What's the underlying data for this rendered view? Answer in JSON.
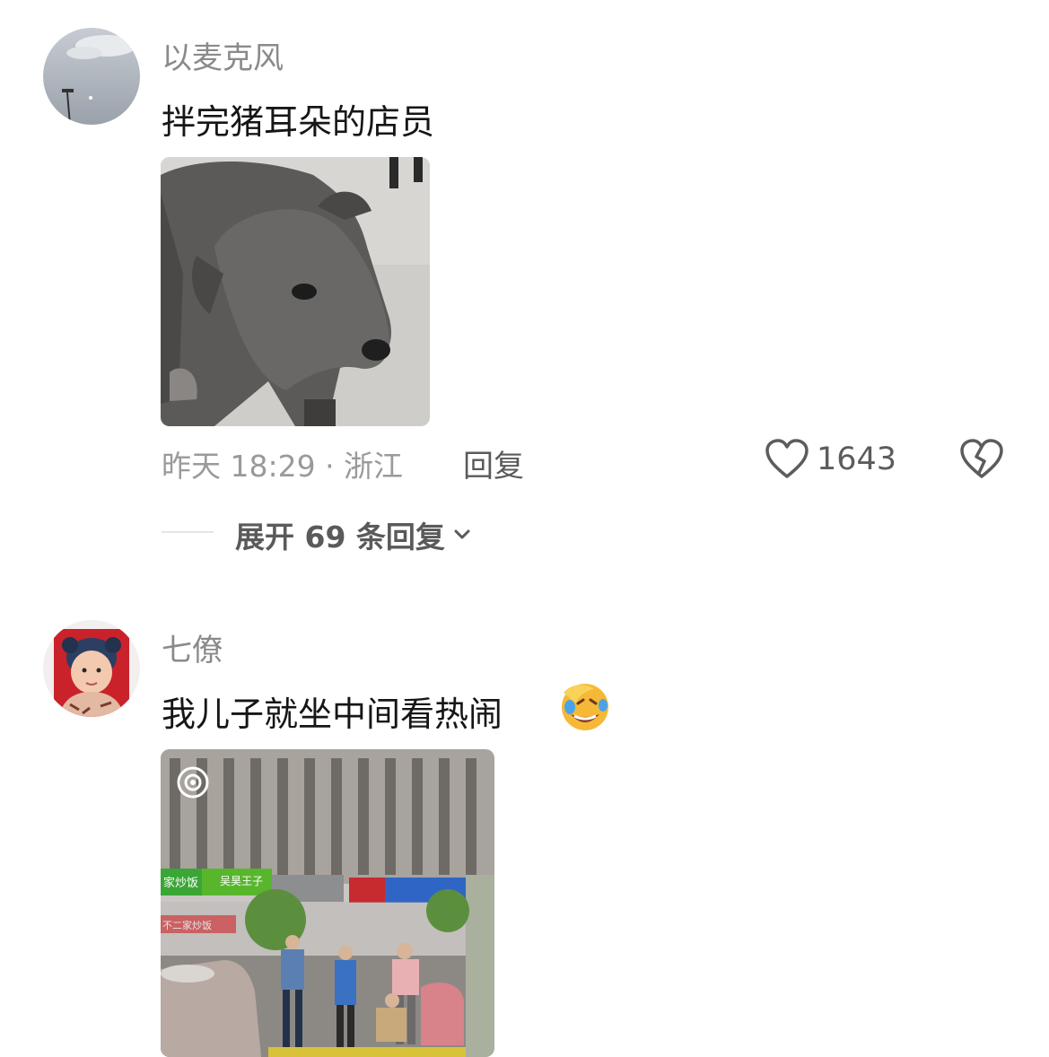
{
  "comments": [
    {
      "username": "以麦克风",
      "text": "拌完猪耳朵的店员",
      "time_location": "昨天 18:29 · 浙江",
      "reply_label": "回复",
      "like_count": "1643",
      "expand_label": "展开 69 条回复",
      "image_icon": "dog-photo"
    },
    {
      "username": "七僚",
      "text": "我儿子就坐中间看热闹",
      "emoji": "laughing-crying-emoji",
      "image_icon": "street-scene-photo",
      "sign_text_1": "家炒饭",
      "sign_text_2": "吴昊王子",
      "sign_text_3": "不二家炒饭"
    }
  ],
  "colors": {
    "username": "#8a8a8a",
    "text": "#161616",
    "meta": "#9a9a9a",
    "icon": "#5c5c5c"
  }
}
